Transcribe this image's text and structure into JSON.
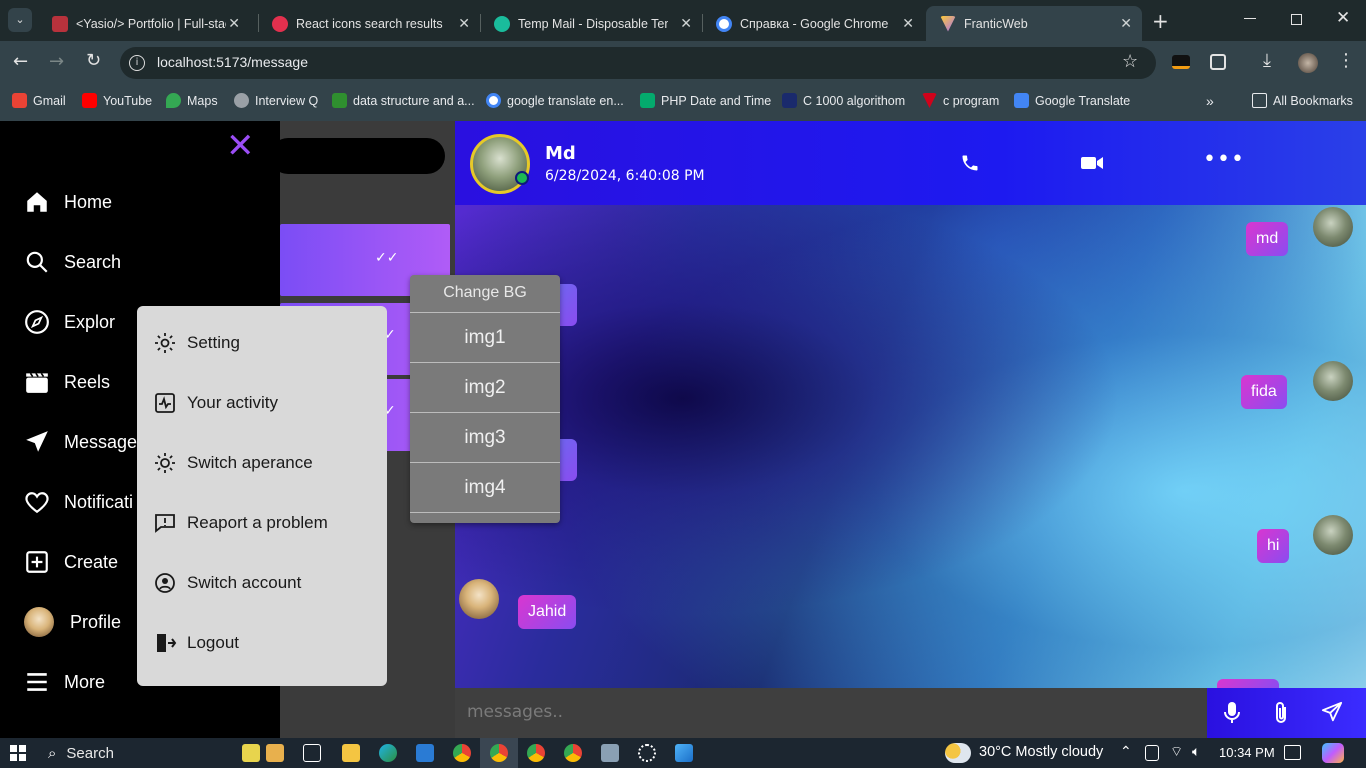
{
  "browser": {
    "tabs": [
      {
        "title": "<Yasio/> Portfolio | Full-stac",
        "color": "#b7323c"
      },
      {
        "title": "React icons search results",
        "color": "#e2304e"
      },
      {
        "title": "Temp Mail - Disposable Temp",
        "color": "#1abc9c"
      },
      {
        "title": "Справка - Google Chrome",
        "color": "#4285f4"
      },
      {
        "title": "FranticWeb",
        "color": "#a36cf7"
      }
    ],
    "url": "localhost:5173/message",
    "bookmarks": [
      {
        "label": "Gmail",
        "color": "#ea4335"
      },
      {
        "label": "YouTube",
        "color": "#ff0000"
      },
      {
        "label": "Maps",
        "color": "#34a853"
      },
      {
        "label": "Interview Q",
        "color": "#9aa0a6"
      },
      {
        "label": "data structure and a...",
        "color": "#2f8f2f"
      },
      {
        "label": "google translate en...",
        "color": "#4285f4"
      },
      {
        "label": "PHP Date and Time",
        "color": "#04aa6d"
      },
      {
        "label": "C 1000  algorithom",
        "color": "#1a2a6c"
      },
      {
        "label": "c program",
        "color": "#d0021b"
      },
      {
        "label": "Google Translate",
        "color": "#4285f4"
      }
    ],
    "all_bookmarks": "All Bookmarks"
  },
  "sidenav": {
    "items": [
      {
        "label": "Home",
        "icon": "home-icon"
      },
      {
        "label": "Search",
        "icon": "search-icon"
      },
      {
        "label": "Explor",
        "icon": "compass-icon"
      },
      {
        "label": "Reels",
        "icon": "clapperboard-icon"
      },
      {
        "label": "Message",
        "icon": "send-icon"
      },
      {
        "label": "Notificati",
        "icon": "heart-icon"
      },
      {
        "label": "Create",
        "icon": "plus-square-icon"
      },
      {
        "label": "Profile",
        "icon": "avatar"
      },
      {
        "label": "More",
        "icon": "menu-icon"
      }
    ]
  },
  "more_menu": {
    "items": [
      {
        "label": "Setting",
        "icon": "gear-icon"
      },
      {
        "label": "Your activity",
        "icon": "activity-icon"
      },
      {
        "label": "Switch aperance",
        "icon": "sun-icon"
      },
      {
        "label": "Reaport a problem",
        "icon": "report-icon"
      },
      {
        "label": "Switch account",
        "icon": "switch-account-icon"
      },
      {
        "label": "Logout",
        "icon": "logout-icon"
      }
    ]
  },
  "bg_menu": {
    "title": "Change BG",
    "options": [
      "img1",
      "img2",
      "img3",
      "img4"
    ]
  },
  "chat": {
    "contact_name": "Md",
    "timestamp": "6/28/2024, 6:40:08 PM",
    "messages": [
      {
        "text": "md",
        "side": "right"
      },
      {
        "text": "fida",
        "side": "right"
      },
      {
        "text": "hi",
        "side": "right"
      },
      {
        "text": "Jahid",
        "side": "left"
      }
    ],
    "input_placeholder": "messages.."
  },
  "taskbar": {
    "search_label": "Search",
    "weather": "30°C  Mostly cloudy",
    "time": "10:34 PM"
  }
}
